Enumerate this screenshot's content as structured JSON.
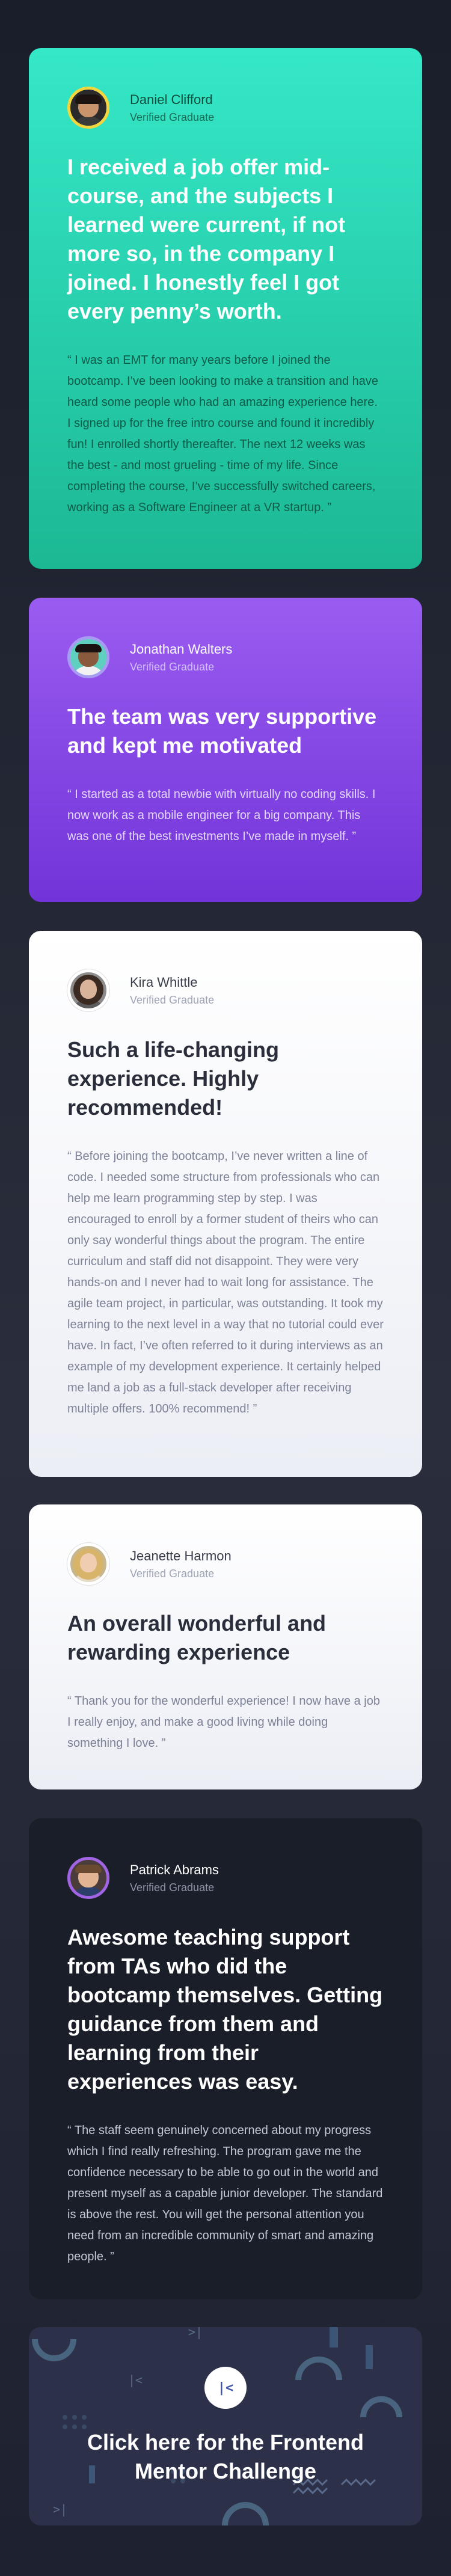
{
  "testimonials": [
    {
      "name": "Daniel Clifford",
      "status": "Verified Graduate",
      "headline": "I received a job offer mid-course, and the subjects I learned were current, if not more so, in the company I joined. I honestly feel I got every penny’s worth.",
      "quote": "“ I was an EMT for many years before I joined the bootcamp. I’ve been looking to make a transition and have heard some people who had an amazing experience here. I signed up for the free intro course and found it incredibly fun! I enrolled shortly thereafter. The next 12 weeks was the best - and most grueling - time of my life. Since completing the course, I’ve successfully switched careers, working as a Software Engineer at a VR startup. ”"
    },
    {
      "name": "Jonathan Walters",
      "status": "Verified Graduate",
      "headline": "The team was very supportive and kept me motivated",
      "quote": "“ I started as a total newbie with virtually no coding skills. I now work as a mobile engineer for a big company. This was one of the best investments I’ve made in myself. ”"
    },
    {
      "name": "Kira Whittle",
      "status": "Verified Graduate",
      "headline": "Such a life-changing experience. Highly recommended!",
      "quote": "“ Before joining the bootcamp, I’ve never written a line of code. I needed some structure from professionals who can help me learn programming step by step. I was encouraged to enroll by a former student of theirs who can only say wonderful things about the program. The entire curriculum and staff did not disappoint. They were very hands-on and I never had to wait long for assistance. The agile team project, in particular, was outstanding. It took my learning to the next level in a way that no tutorial could ever have. In fact, I’ve often referred to it during interviews as an example of my development experience. It certainly helped me land a job as a full-stack developer after receiving multiple offers. 100% recommend! ”"
    },
    {
      "name": "Jeanette Harmon",
      "status": "Verified Graduate",
      "headline": "An overall wonderful and rewarding experience",
      "quote": "“ Thank you for the wonderful experience! I now have a job I really enjoy, and make a good living while doing something I love. ”"
    },
    {
      "name": "Patrick Abrams",
      "status": "Verified Graduate",
      "headline": "Awesome teaching support from TAs who did the bootcamp themselves. Getting guidance from them and learning from their experiences was easy.",
      "quote": "“ The staff seem genuinely concerned about my progress which I find really refreshing. The program gave me the confidence necessary to be able to go out in the world and present myself as a capable junior developer. The standard is above the rest. You will get the personal attention you need from an incredible community of smart and amazing people. ”"
    }
  ],
  "cta": {
    "label": "Click here for the Frontend Mentor Challenge",
    "logo_icon": "frontend-mentor-logo-icon"
  },
  "colors": {
    "card1_bg": "#2ad6b4",
    "card2_bg": "#8146e6",
    "card3_bg": "#ffffff",
    "card4_bg": "#ffffff",
    "card5_bg": "#1a1e28",
    "cta_bg": "#2c3048"
  }
}
